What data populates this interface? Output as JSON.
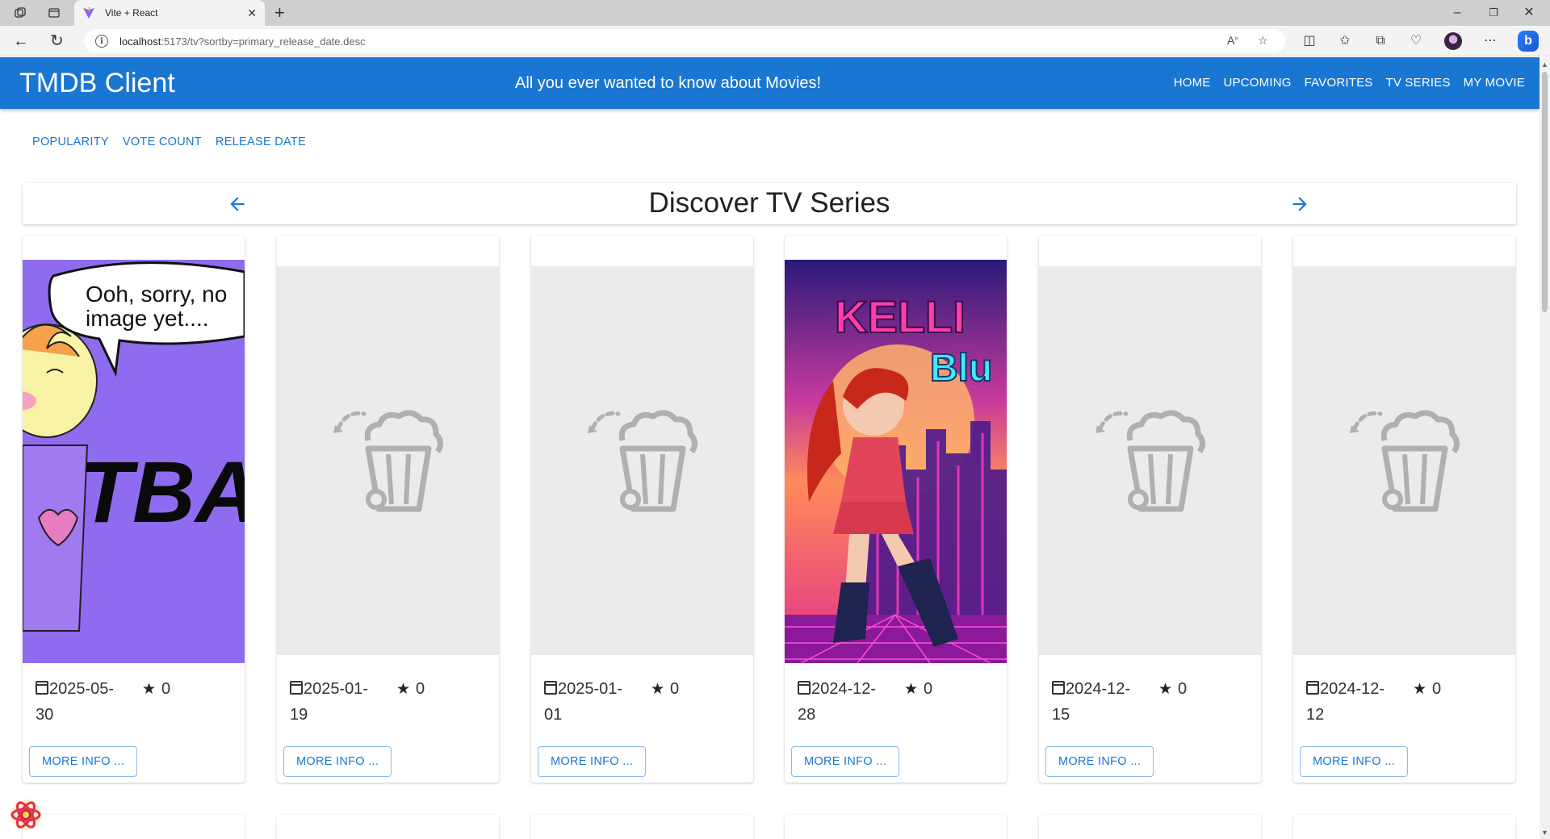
{
  "browser": {
    "tab_title": "Vite + React",
    "url_host": "localhost",
    "url_rest": ":5173/tv?sortby=primary_release_date.desc"
  },
  "header": {
    "brand": "TMDB Client",
    "tagline": "All you ever wanted to know about Movies!",
    "nav": [
      "HOME",
      "UPCOMING",
      "FAVORITES",
      "TV SERIES",
      "MY MOVIE"
    ]
  },
  "sort": {
    "options": [
      "POPULARITY",
      "VOTE COUNT",
      "RELEASE DATE"
    ]
  },
  "discover": {
    "title": "Discover TV Series"
  },
  "cards": [
    {
      "date_line1": "2025-05-",
      "date_line2": "30",
      "rating": "0",
      "poster": "no-image-yet",
      "button": "MORE INFO ...",
      "poster_text": [
        "Ooh, sorry, no",
        "image yet....",
        "TBA"
      ]
    },
    {
      "date_line1": "2025-01-",
      "date_line2": "19",
      "rating": "0",
      "poster": "placeholder",
      "button": "MORE INFO ..."
    },
    {
      "date_line1": "2025-01-",
      "date_line2": "01",
      "rating": "0",
      "poster": "placeholder",
      "button": "MORE INFO ..."
    },
    {
      "date_line1": "2024-12-",
      "date_line2": "28",
      "rating": "0",
      "poster": "kelli-blu",
      "button": "MORE INFO ...",
      "poster_text": [
        "KELLI",
        "Blu"
      ]
    },
    {
      "date_line1": "2024-12-",
      "date_line2": "15",
      "rating": "0",
      "poster": "placeholder",
      "button": "MORE INFO ..."
    },
    {
      "date_line1": "2024-12-",
      "date_line2": "12",
      "rating": "0",
      "poster": "placeholder",
      "button": "MORE INFO ..."
    }
  ],
  "colors": {
    "primary": "#1976d2",
    "placeholder_bg": "#ebebeb"
  },
  "icons": [
    "back-arrow-icon",
    "forward-arrow-icon",
    "calendar-icon",
    "star-icon",
    "popcorn-placeholder-icon"
  ]
}
